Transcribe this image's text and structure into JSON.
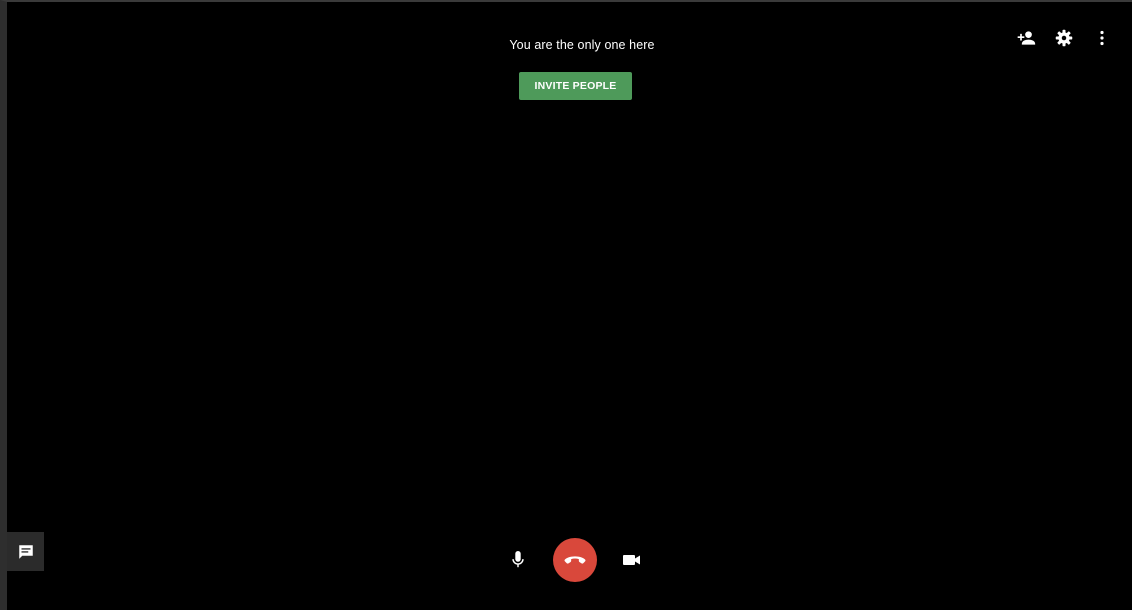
{
  "call": {
    "status_text": "You are the only one here",
    "invite_label": "INVITE PEOPLE"
  },
  "toolbar": {
    "icons": [
      "add-person-icon",
      "gear-icon",
      "more-vert-icon"
    ]
  },
  "controls": {
    "icons": [
      "microphone-icon",
      "hang-up-icon",
      "video-camera-icon"
    ]
  },
  "chat": {
    "icon": "chat-icon"
  },
  "colors": {
    "background": "#000000",
    "invite_button": "#4e9a5a",
    "hang_up": "#d9483b",
    "icon": "#ffffff",
    "chat_panel": "#2b2b2b"
  }
}
